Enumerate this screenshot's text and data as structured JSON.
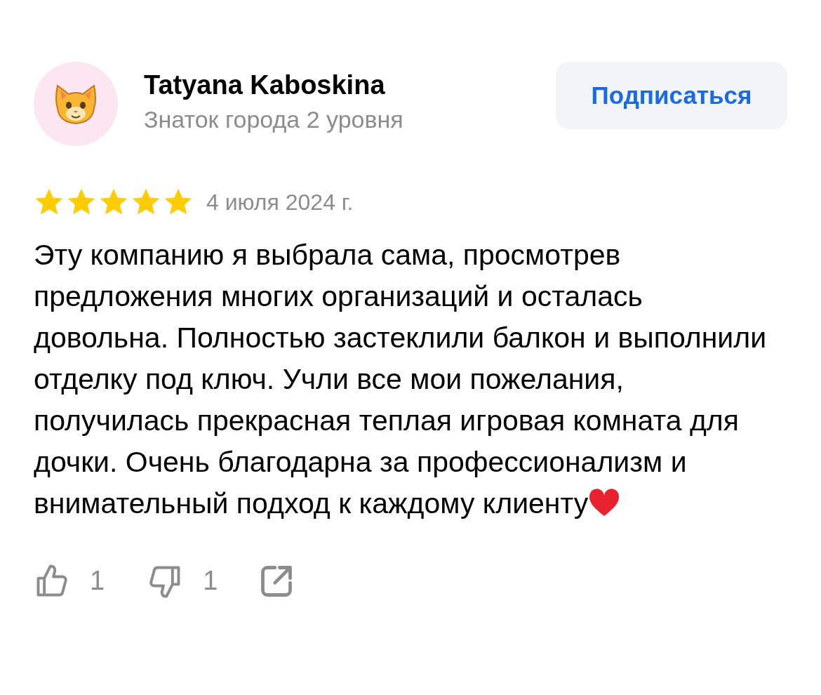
{
  "author": {
    "name": "Tatyana Kaboskina",
    "level": "Знаток города 2 уровня"
  },
  "subscribe_button": {
    "label": "Подписаться"
  },
  "review": {
    "stars": 5,
    "date": "4 июля 2024 г.",
    "text": "Эту компанию я выбрала сама, просмотрев предложения многих организаций и осталась довольна. Полностью застеклили балкон и выполнили отделку под ключ. Учли все мои пожелания, получилась прекрасная теплая игровая комната для дочки. Очень благодарна за профессионализм и внимательный подход к каждому клиенту"
  },
  "actions": {
    "likes": "1",
    "dislikes": "1"
  }
}
